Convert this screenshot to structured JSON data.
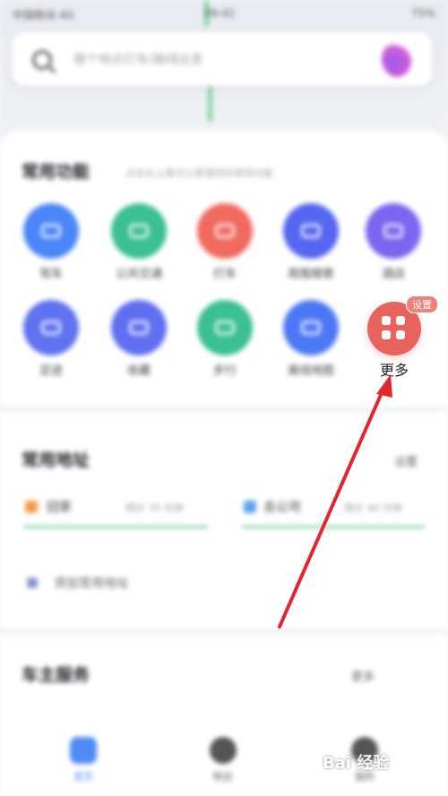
{
  "status_bar": {
    "carrier": "中国移动 4G",
    "time": "09:41",
    "battery": "75%"
  },
  "search": {
    "placeholder": "搜个地点打车/路线出发"
  },
  "common_functions": {
    "title": "常用功能",
    "subtitle": "点击右上角可以管理您的常用功能",
    "items": [
      {
        "label": "驾车",
        "color": "#4a86f7"
      },
      {
        "label": "公共交通",
        "color": "#3bbf95"
      },
      {
        "label": "打车",
        "color": "#f06a5f"
      },
      {
        "label": "周围搜索",
        "color": "#5566f0"
      },
      {
        "label": "酒店",
        "color": "#7a66f0"
      },
      {
        "label": "足迹",
        "color": "#5f72f0"
      },
      {
        "label": "收藏",
        "color": "#5f6ff0"
      },
      {
        "label": "步行",
        "color": "#3bbf95"
      },
      {
        "label": "离线地图",
        "color": "#4c78f5"
      }
    ],
    "more": {
      "label": "更多",
      "badge": "设置",
      "color": "#e8625e"
    }
  },
  "common_addresses": {
    "title": "常用地址",
    "action": "设置",
    "home": {
      "label": "回家",
      "meta": "预计 35 分钟"
    },
    "work": {
      "label": "去公司",
      "meta": "预计 40 分钟"
    },
    "add": "添加常用地址"
  },
  "car_service": {
    "title": "车主服务",
    "action": "更多"
  },
  "tabs": [
    {
      "label": "首页",
      "active": true
    },
    {
      "label": "附近",
      "active": false
    },
    {
      "label": "我的",
      "active": false
    }
  ],
  "watermark": "Bai 经验",
  "annotation": {
    "color": "#e3262e"
  }
}
